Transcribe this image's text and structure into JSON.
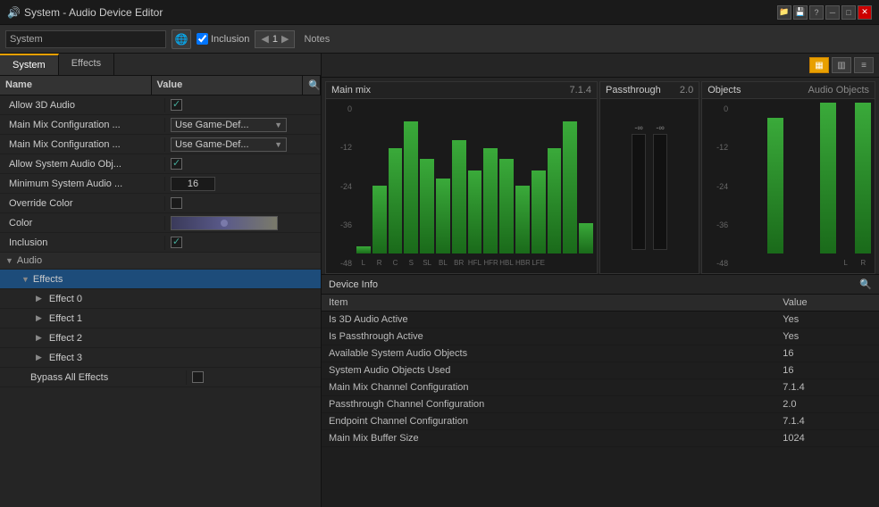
{
  "titlebar": {
    "title": "System - Audio Device Editor",
    "icon": "🔊",
    "controls": [
      "minimize",
      "maximize",
      "close"
    ]
  },
  "toolbar": {
    "system_label": "System",
    "globe_icon": "🌐",
    "inclusion_label": "Inclusion",
    "inclusion_checked": true,
    "counter_value": "1",
    "notes_label": "Notes"
  },
  "tabs": [
    {
      "id": "system",
      "label": "System",
      "active": true
    },
    {
      "id": "effects",
      "label": "Effects",
      "active": false
    }
  ],
  "properties": {
    "header": {
      "name": "Name",
      "value": "Value"
    },
    "rows": [
      {
        "name": "Allow 3D Audio",
        "type": "checkbox",
        "checked": true
      },
      {
        "name": "Main Mix Configuration ...",
        "type": "dropdown",
        "value": "Use Game-Def..."
      },
      {
        "name": "Main Mix Configuration ...",
        "type": "dropdown",
        "value": "Use Game-Def..."
      },
      {
        "name": "Allow System Audio Obj...",
        "type": "checkbox",
        "checked": true
      },
      {
        "name": "Minimum System Audio ...",
        "type": "number",
        "value": "16"
      },
      {
        "name": "Override Color",
        "type": "checkbox",
        "checked": false
      },
      {
        "name": "Color",
        "type": "color"
      },
      {
        "name": "Inclusion",
        "type": "checkbox",
        "checked": true
      }
    ],
    "sections": [
      {
        "label": "Audio",
        "expanded": true,
        "children": [
          {
            "label": "Effects",
            "expanded": true,
            "selected": true,
            "children": [
              {
                "label": "Effect 0",
                "expanded": false
              },
              {
                "label": "Effect 1",
                "expanded": false
              },
              {
                "label": "Effect 2",
                "expanded": false
              },
              {
                "label": "Effect 3",
                "expanded": false
              }
            ]
          }
        ]
      }
    ],
    "bypass_label": "Bypass All Effects",
    "bypass_checked": false
  },
  "meters": {
    "main_mix": {
      "title": "Main mix",
      "config": "7.1.4",
      "bars": [
        2,
        18,
        28,
        35,
        25,
        20,
        30,
        22,
        28,
        25,
        18,
        22,
        28,
        35,
        8
      ],
      "labels": [
        "L",
        "R",
        "C",
        "S",
        "SL",
        "BL",
        "BR",
        "HFL",
        "HFR",
        "HBL",
        "HBR",
        "LFE"
      ],
      "scale": [
        "0",
        "-12",
        "-24",
        "-36",
        "-48"
      ]
    },
    "passthrough": {
      "title": "Passthrough",
      "config": "2.0",
      "left_db": "-∞",
      "right_db": "-∞"
    },
    "objects": {
      "title": "Objects",
      "config": "Audio Objects",
      "bars": [
        0,
        0,
        45,
        0,
        0,
        55,
        0,
        70
      ],
      "scale": [
        "0",
        "-12",
        "-24",
        "-36",
        "-48"
      ],
      "labels": [
        "L",
        "R"
      ]
    }
  },
  "device_info": {
    "title": "Device Info",
    "columns": [
      "Item",
      "Value"
    ],
    "rows": [
      {
        "item": "Is 3D Audio Active",
        "value": "Yes"
      },
      {
        "item": "Is Passthrough Active",
        "value": "Yes"
      },
      {
        "item": "Available System Audio Objects",
        "value": "16"
      },
      {
        "item": "System Audio Objects Used",
        "value": "16"
      },
      {
        "item": "Main Mix Channel Configuration",
        "value": "7.1.4"
      },
      {
        "item": "Passthrough Channel Configuration",
        "value": "2.0"
      },
      {
        "item": "Endpoint Channel Configuration",
        "value": "7.1.4"
      },
      {
        "item": "Main Mix Buffer Size",
        "value": "1024"
      }
    ]
  },
  "view_buttons": [
    {
      "icon": "▦",
      "active": true,
      "label": "grid-view"
    },
    {
      "icon": "▥",
      "active": false,
      "label": "split-view"
    },
    {
      "icon": "≡",
      "active": false,
      "label": "list-view"
    }
  ]
}
